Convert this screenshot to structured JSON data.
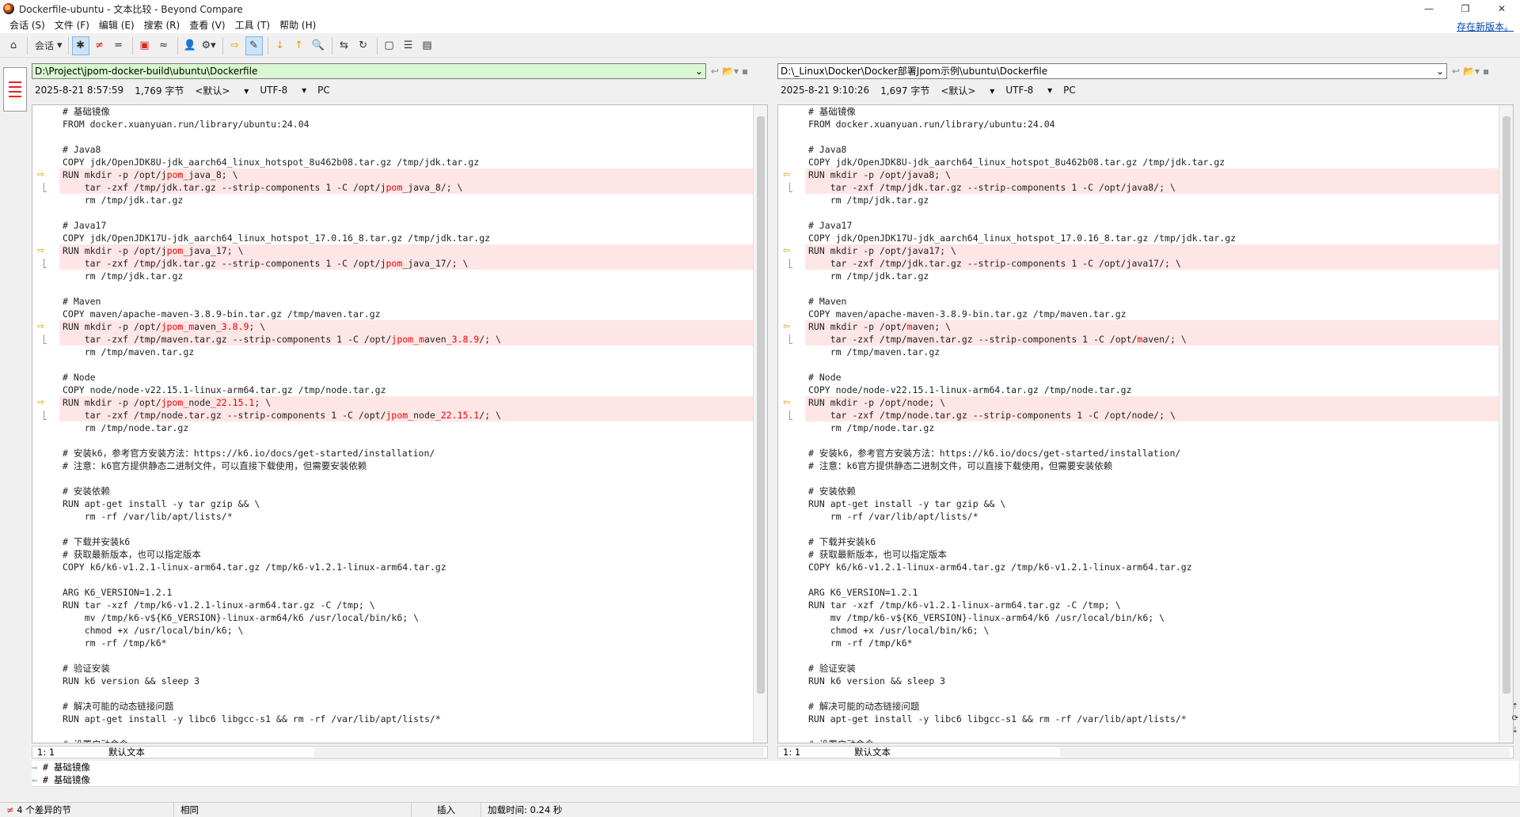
{
  "window": {
    "title": "Dockerfile-ubuntu - 文本比较 - Beyond Compare",
    "minimize": "—",
    "maximize": "❐",
    "close": "✕"
  },
  "menu": [
    "会话 (S)",
    "文件 (F)",
    "编辑 (E)",
    "搜索 (R)",
    "查看 (V)",
    "工具 (T)",
    "帮助 (H)"
  ],
  "update_link": "存在新版本。",
  "toolbar": {
    "session_label": "会话",
    "eq_glyph": "=",
    "approx_glyph": "≈"
  },
  "left": {
    "path": "D:\\Project\\jpom-docker-build\\ubuntu\\Dockerfile",
    "datetime": "2025-8-21 8:57:59",
    "size": "1,769 字节",
    "format": "<默认>",
    "encoding": "UTF-8",
    "lineend": "PC",
    "cursor": "1: 1",
    "mode": "默认文本"
  },
  "right": {
    "path": "D:\\_Linux\\Docker\\Docker部署Jpom示例\\ubuntu\\Dockerfile",
    "datetime": "2025-8-21 9:10:26",
    "size": "1,697 字节",
    "format": "<默认>",
    "encoding": "UTF-8",
    "lineend": "PC",
    "cursor": "1: 1",
    "mode": "默认文本"
  },
  "left_lines": [
    {
      "t": [
        [
          "# 基础镜像",
          0
        ]
      ]
    },
    {
      "t": [
        [
          "FROM docker.xuanyuan.run/library/ubuntu:24.04",
          0
        ]
      ]
    },
    {
      "t": [
        [
          "",
          0
        ]
      ]
    },
    {
      "t": [
        [
          "# Java8",
          0
        ]
      ]
    },
    {
      "t": [
        [
          "COPY jdk/OpenJDK8U-jdk_aarch64_linux_hotspot_8u462b08.tar.gz /tmp/jdk.tar.gz",
          0
        ]
      ]
    },
    {
      "d": 1,
      "m": 1,
      "t": [
        [
          "RUN mkdir -p /opt/j",
          0
        ],
        [
          "pom",
          1
        ],
        [
          "_java_8; \\",
          0
        ]
      ]
    },
    {
      "d": 1,
      "t": [
        [
          "    tar -zxf /tmp/jdk.tar.gz --strip-components 1 -C /opt/j",
          0
        ],
        [
          "pom",
          1
        ],
        [
          "_java_8/; \\",
          0
        ]
      ]
    },
    {
      "t": [
        [
          "    rm /tmp/jdk.tar.gz",
          0
        ]
      ]
    },
    {
      "t": [
        [
          "",
          0
        ]
      ]
    },
    {
      "t": [
        [
          "# Java17",
          0
        ]
      ]
    },
    {
      "t": [
        [
          "COPY jdk/OpenJDK17U-jdk_aarch64_linux_hotspot_17.0.16_8.tar.gz /tmp/jdk.tar.gz",
          0
        ]
      ]
    },
    {
      "d": 1,
      "m": 1,
      "t": [
        [
          "RUN mkdir -p /opt/j",
          0
        ],
        [
          "pom",
          1
        ],
        [
          "_java_17; \\",
          0
        ]
      ]
    },
    {
      "d": 1,
      "t": [
        [
          "    tar -zxf /tmp/jdk.tar.gz --strip-components 1 -C /opt/j",
          0
        ],
        [
          "pom",
          1
        ],
        [
          "_java_17/; \\",
          0
        ]
      ]
    },
    {
      "t": [
        [
          "    rm /tmp/jdk.tar.gz",
          0
        ]
      ]
    },
    {
      "t": [
        [
          "",
          0
        ]
      ]
    },
    {
      "t": [
        [
          "# Maven",
          0
        ]
      ]
    },
    {
      "t": [
        [
          "COPY maven/apache-maven-3.8.9-bin.tar.gz /tmp/maven.tar.gz",
          0
        ]
      ]
    },
    {
      "d": 1,
      "m": 1,
      "t": [
        [
          "RUN mkdir -p /opt/",
          0
        ],
        [
          "jpom_m",
          1
        ],
        [
          "aven",
          0
        ],
        [
          "_3.8.9",
          1
        ],
        [
          "; \\",
          0
        ]
      ]
    },
    {
      "d": 1,
      "t": [
        [
          "    tar -zxf /tmp/maven.tar.gz --strip-components 1 -C /opt/",
          0
        ],
        [
          "jpom_m",
          1
        ],
        [
          "aven",
          0
        ],
        [
          "_3.8.9",
          1
        ],
        [
          "/; \\",
          0
        ]
      ]
    },
    {
      "t": [
        [
          "    rm /tmp/maven.tar.gz",
          0
        ]
      ]
    },
    {
      "t": [
        [
          "",
          0
        ]
      ]
    },
    {
      "t": [
        [
          "# Node",
          0
        ]
      ]
    },
    {
      "t": [
        [
          "COPY node/node-v22.15.1-linux-arm64.tar.gz /tmp/node.tar.gz",
          0
        ]
      ]
    },
    {
      "d": 1,
      "m": 1,
      "t": [
        [
          "RUN mkdir -p /opt/",
          0
        ],
        [
          "jpom_",
          1
        ],
        [
          "node",
          0
        ],
        [
          "_22.15.1",
          1
        ],
        [
          "; \\",
          0
        ]
      ]
    },
    {
      "d": 1,
      "t": [
        [
          "    tar -zxf /tmp/node.tar.gz --strip-components 1 -C /opt/",
          0
        ],
        [
          "jpom_",
          1
        ],
        [
          "node",
          0
        ],
        [
          "_22.15.1",
          1
        ],
        [
          "/; \\",
          0
        ]
      ]
    },
    {
      "t": [
        [
          "    rm /tmp/node.tar.gz",
          0
        ]
      ]
    },
    {
      "t": [
        [
          "",
          0
        ]
      ]
    },
    {
      "t": [
        [
          "# 安装k6，参考官方安装方法：https://k6.io/docs/get-started/installation/",
          0
        ]
      ]
    },
    {
      "t": [
        [
          "# 注意：k6官方提供静态二进制文件，可以直接下载使用，但需要安装依赖",
          0
        ]
      ]
    },
    {
      "t": [
        [
          "",
          0
        ]
      ]
    },
    {
      "t": [
        [
          "# 安装依赖",
          0
        ]
      ]
    },
    {
      "t": [
        [
          "RUN apt-get install -y tar gzip && \\",
          0
        ]
      ]
    },
    {
      "t": [
        [
          "    rm -rf /var/lib/apt/lists/*",
          0
        ]
      ]
    },
    {
      "t": [
        [
          "",
          0
        ]
      ]
    },
    {
      "t": [
        [
          "# 下载并安装k6",
          0
        ]
      ]
    },
    {
      "t": [
        [
          "# 获取最新版本，也可以指定版本",
          0
        ]
      ]
    },
    {
      "t": [
        [
          "COPY k6/k6-v1.2.1-linux-arm64.tar.gz /tmp/k6-v1.2.1-linux-arm64.tar.gz",
          0
        ]
      ]
    },
    {
      "t": [
        [
          "",
          0
        ]
      ]
    },
    {
      "t": [
        [
          "ARG K6_VERSION=1.2.1",
          0
        ]
      ]
    },
    {
      "t": [
        [
          "RUN tar -xzf /tmp/k6-v1.2.1-linux-arm64.tar.gz -C /tmp; \\",
          0
        ]
      ]
    },
    {
      "t": [
        [
          "    mv /tmp/k6-v${K6_VERSION}-linux-arm64/k6 /usr/local/bin/k6; \\",
          0
        ]
      ]
    },
    {
      "t": [
        [
          "    chmod +x /usr/local/bin/k6; \\",
          0
        ]
      ]
    },
    {
      "t": [
        [
          "    rm -rf /tmp/k6*",
          0
        ]
      ]
    },
    {
      "t": [
        [
          "",
          0
        ]
      ]
    },
    {
      "t": [
        [
          "# 验证安装",
          0
        ]
      ]
    },
    {
      "t": [
        [
          "RUN k6 version && sleep 3",
          0
        ]
      ]
    },
    {
      "t": [
        [
          "",
          0
        ]
      ]
    },
    {
      "t": [
        [
          "# 解决可能的动态链接问题",
          0
        ]
      ]
    },
    {
      "t": [
        [
          "RUN apt-get install -y libc6 libgcc-s1 && rm -rf /var/lib/apt/lists/*",
          0
        ]
      ]
    },
    {
      "t": [
        [
          "",
          0
        ]
      ]
    },
    {
      "t": [
        [
          "# 设置启动命令",
          0
        ]
      ]
    }
  ],
  "right_lines": [
    {
      "t": [
        [
          "# 基础镜像",
          0
        ]
      ]
    },
    {
      "t": [
        [
          "FROM docker.xuanyuan.run/library/ubuntu:24.04",
          0
        ]
      ]
    },
    {
      "t": [
        [
          "",
          0
        ]
      ]
    },
    {
      "t": [
        [
          "# Java8",
          0
        ]
      ]
    },
    {
      "t": [
        [
          "COPY jdk/OpenJDK8U-jdk_aarch64_linux_hotspot_8u462b08.tar.gz /tmp/jdk.tar.gz",
          0
        ]
      ]
    },
    {
      "d": 1,
      "m": 1,
      "t": [
        [
          "RUN mkdir -p /opt/java8; \\",
          0
        ]
      ]
    },
    {
      "d": 1,
      "t": [
        [
          "    tar -zxf /tmp/jdk.tar.gz --strip-components 1 -C /opt/java8/; \\",
          0
        ]
      ]
    },
    {
      "t": [
        [
          "    rm /tmp/jdk.tar.gz",
          0
        ]
      ]
    },
    {
      "t": [
        [
          "",
          0
        ]
      ]
    },
    {
      "t": [
        [
          "# Java17",
          0
        ]
      ]
    },
    {
      "t": [
        [
          "COPY jdk/OpenJDK17U-jdk_aarch64_linux_hotspot_17.0.16_8.tar.gz /tmp/jdk.tar.gz",
          0
        ]
      ]
    },
    {
      "d": 1,
      "m": 1,
      "t": [
        [
          "RUN mkdir -p /opt/java17; \\",
          0
        ]
      ]
    },
    {
      "d": 1,
      "t": [
        [
          "    tar -zxf /tmp/jdk.tar.gz --strip-components 1 -C /opt/java17/; \\",
          0
        ]
      ]
    },
    {
      "t": [
        [
          "    rm /tmp/jdk.tar.gz",
          0
        ]
      ]
    },
    {
      "t": [
        [
          "",
          0
        ]
      ]
    },
    {
      "t": [
        [
          "# Maven",
          0
        ]
      ]
    },
    {
      "t": [
        [
          "COPY maven/apache-maven-3.8.9-bin.tar.gz /tmp/maven.tar.gz",
          0
        ]
      ]
    },
    {
      "d": 1,
      "m": 1,
      "t": [
        [
          "RUN mkdir -p /opt/",
          0
        ],
        [
          "m",
          1
        ],
        [
          "aven; \\",
          0
        ]
      ]
    },
    {
      "d": 1,
      "t": [
        [
          "    tar -zxf /tmp/maven.tar.gz --strip-components 1 -C /opt/",
          0
        ],
        [
          "m",
          1
        ],
        [
          "aven/; \\",
          0
        ]
      ]
    },
    {
      "t": [
        [
          "    rm /tmp/maven.tar.gz",
          0
        ]
      ]
    },
    {
      "t": [
        [
          "",
          0
        ]
      ]
    },
    {
      "t": [
        [
          "# Node",
          0
        ]
      ]
    },
    {
      "t": [
        [
          "COPY node/node-v22.15.1-linux-arm64.tar.gz /tmp/node.tar.gz",
          0
        ]
      ]
    },
    {
      "d": 1,
      "m": 1,
      "t": [
        [
          "RUN mkdir -p /opt/node; \\",
          0
        ]
      ]
    },
    {
      "d": 1,
      "t": [
        [
          "    tar -zxf /tmp/node.tar.gz --strip-components 1 -C /opt/node/; \\",
          0
        ]
      ]
    },
    {
      "t": [
        [
          "    rm /tmp/node.tar.gz",
          0
        ]
      ]
    },
    {
      "t": [
        [
          "",
          0
        ]
      ]
    },
    {
      "t": [
        [
          "# 安装k6，参考官方安装方法：https://k6.io/docs/get-started/installation/",
          0
        ]
      ]
    },
    {
      "t": [
        [
          "# 注意：k6官方提供静态二进制文件，可以直接下载使用，但需要安装依赖",
          0
        ]
      ]
    },
    {
      "t": [
        [
          "",
          0
        ]
      ]
    },
    {
      "t": [
        [
          "# 安装依赖",
          0
        ]
      ]
    },
    {
      "t": [
        [
          "RUN apt-get install -y tar gzip && \\",
          0
        ]
      ]
    },
    {
      "t": [
        [
          "    rm -rf /var/lib/apt/lists/*",
          0
        ]
      ]
    },
    {
      "t": [
        [
          "",
          0
        ]
      ]
    },
    {
      "t": [
        [
          "# 下载并安装k6",
          0
        ]
      ]
    },
    {
      "t": [
        [
          "# 获取最新版本，也可以指定版本",
          0
        ]
      ]
    },
    {
      "t": [
        [
          "COPY k6/k6-v1.2.1-linux-arm64.tar.gz /tmp/k6-v1.2.1-linux-arm64.tar.gz",
          0
        ]
      ]
    },
    {
      "t": [
        [
          "",
          0
        ]
      ]
    },
    {
      "t": [
        [
          "ARG K6_VERSION=1.2.1",
          0
        ]
      ]
    },
    {
      "t": [
        [
          "RUN tar -xzf /tmp/k6-v1.2.1-linux-arm64.tar.gz -C /tmp; \\",
          0
        ]
      ]
    },
    {
      "t": [
        [
          "    mv /tmp/k6-v${K6_VERSION}-linux-arm64/k6 /usr/local/bin/k6; \\",
          0
        ]
      ]
    },
    {
      "t": [
        [
          "    chmod +x /usr/local/bin/k6; \\",
          0
        ]
      ]
    },
    {
      "t": [
        [
          "    rm -rf /tmp/k6*",
          0
        ]
      ]
    },
    {
      "t": [
        [
          "",
          0
        ]
      ]
    },
    {
      "t": [
        [
          "# 验证安装",
          0
        ]
      ]
    },
    {
      "t": [
        [
          "RUN k6 version && sleep 3",
          0
        ]
      ]
    },
    {
      "t": [
        [
          "",
          0
        ]
      ]
    },
    {
      "t": [
        [
          "# 解决可能的动态链接问题",
          0
        ]
      ]
    },
    {
      "t": [
        [
          "RUN apt-get install -y libc6 libgcc-s1 && rm -rf /var/lib/apt/lists/*",
          0
        ]
      ]
    },
    {
      "t": [
        [
          "",
          0
        ]
      ]
    },
    {
      "t": [
        [
          "# 设置启动命令",
          0
        ]
      ]
    }
  ],
  "detail": {
    "line1": "# 基础镜像",
    "line2": "# 基础镜像"
  },
  "status": {
    "diffs": "4 个差异的节",
    "same": "相同",
    "insert": "插入",
    "load_time": "加载时间:  0.24 秒"
  },
  "colors": {
    "diff_bg": "#ffe6e6",
    "diff_text": "#e00000",
    "left_path_bg": "#d9f7d0"
  }
}
